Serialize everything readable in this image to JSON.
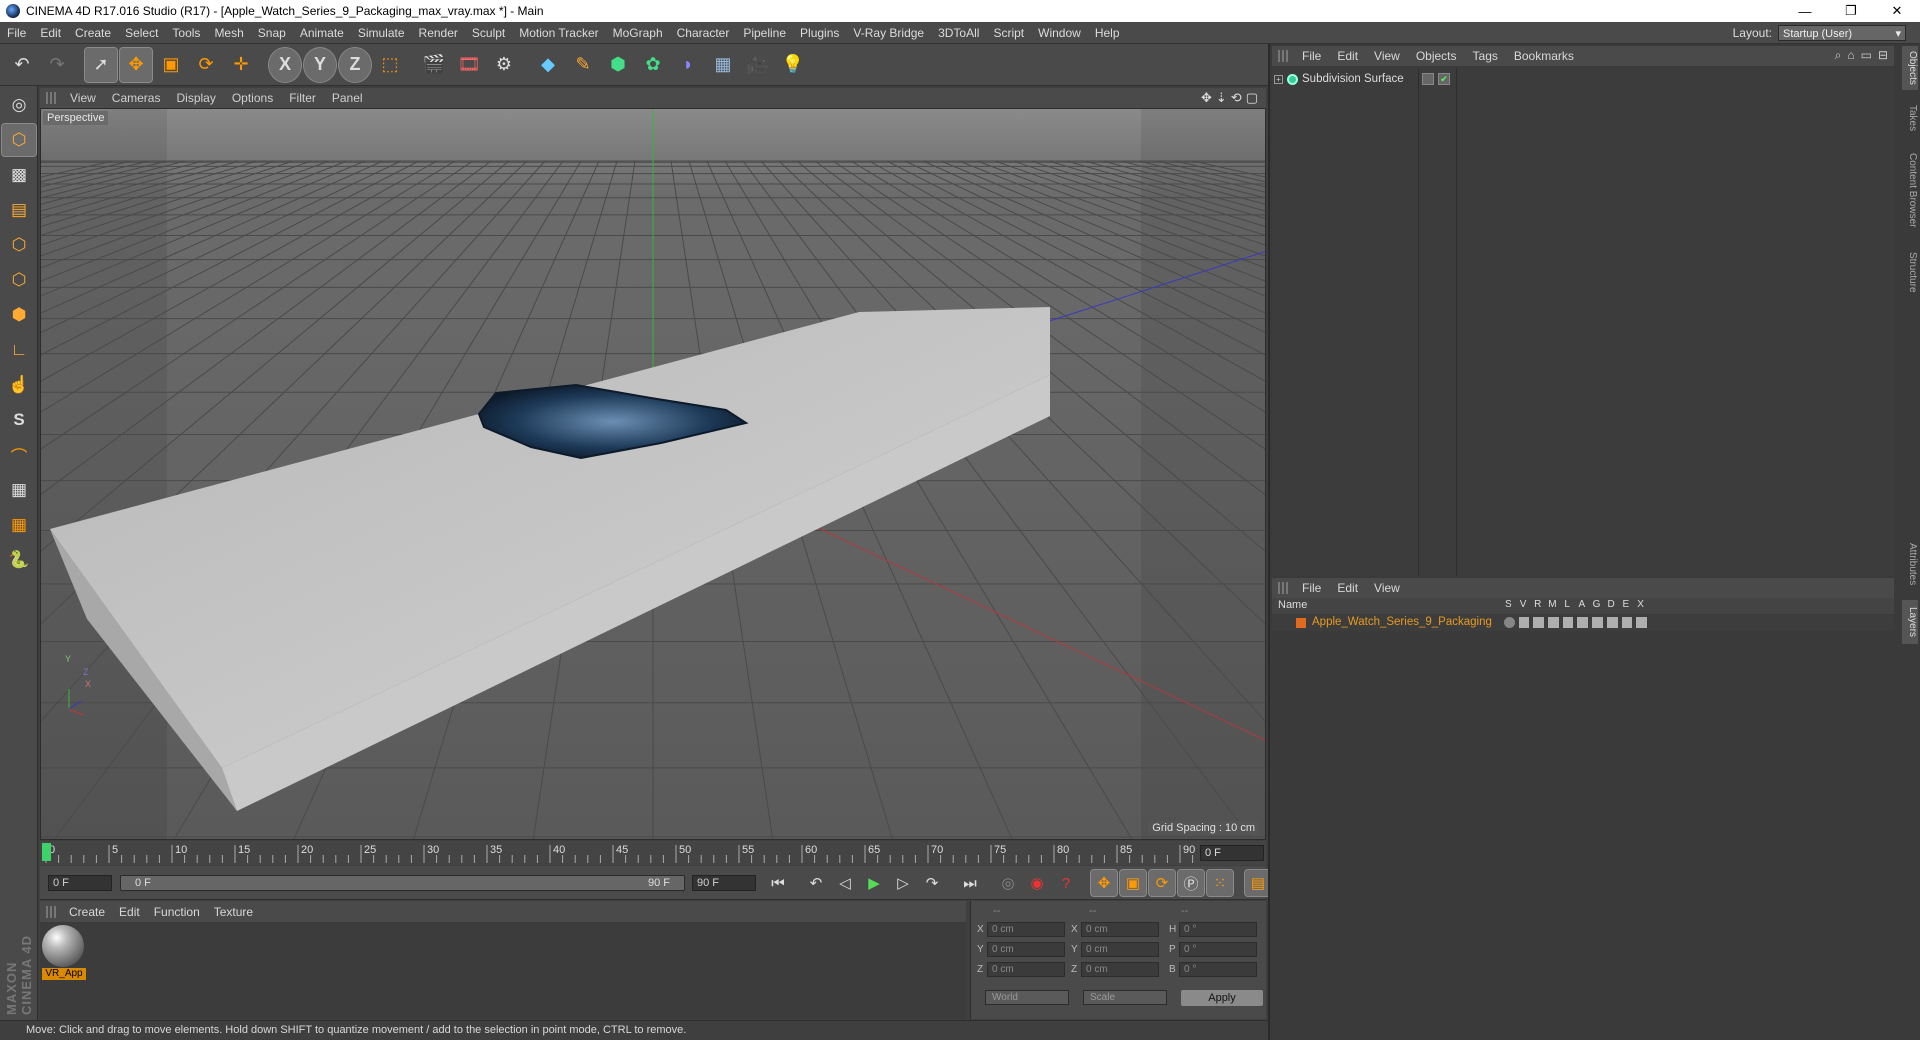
{
  "window": {
    "title": "CINEMA 4D R17.016 Studio (R17) - [Apple_Watch_Series_9_Packaging_max_vray.max *] - Main",
    "minimize": "—",
    "restore": "❐",
    "close": "✕"
  },
  "menubar": [
    "File",
    "Edit",
    "Create",
    "Select",
    "Tools",
    "Mesh",
    "Snap",
    "Animate",
    "Simulate",
    "Render",
    "Sculpt",
    "Motion Tracker",
    "MoGraph",
    "Character",
    "Pipeline",
    "Plugins",
    "V-Ray Bridge",
    "3DToAll",
    "Script",
    "Window",
    "Help"
  ],
  "layout": {
    "label": "Layout:",
    "value": "Startup (User)"
  },
  "toolbar": {
    "icons": [
      "undo-icon",
      "redo-icon",
      "select-icon",
      "move-icon",
      "scale-icon",
      "rotate-icon",
      "live-selection-icon",
      "x-axis-icon",
      "y-axis-icon",
      "z-axis-icon",
      "coordinate-system-icon",
      "render-view-icon",
      "render-picture-viewer-icon",
      "edit-render-settings-icon",
      "cube-icon",
      "pen-icon",
      "subdivision-icon",
      "cloner-icon",
      "deformer-icon",
      "floor-icon",
      "camera-icon",
      "light-icon"
    ],
    "axis_labels": [
      "X",
      "Y",
      "Z"
    ]
  },
  "left_toolbar": {
    "icons": [
      "model-mode-icon",
      "object-mode-icon",
      "texture-mode-icon",
      "workplane-icon",
      "points-mode-icon",
      "edges-mode-icon",
      "polygons-mode-icon",
      "axis-icon",
      "tweak-icon",
      "snap-icon",
      "magnet-icon",
      "lock-icon",
      "workplane-lock-icon",
      "python-icon"
    ],
    "snap_label": "S"
  },
  "viewport": {
    "menu": [
      "View",
      "Cameras",
      "Display",
      "Options",
      "Filter",
      "Panel"
    ],
    "label": "Perspective",
    "grid_spacing": "Grid Spacing : 10 cm",
    "axis_x": "X",
    "axis_y": "Y",
    "axis_z": "Z"
  },
  "timeline": {
    "ticks": [
      "0",
      "5",
      "10",
      "15",
      "20",
      "25",
      "30",
      "35",
      "40",
      "45",
      "50",
      "55",
      "60",
      "65",
      "70",
      "75",
      "80",
      "85",
      "90"
    ],
    "current_frame": "0 F"
  },
  "transport": {
    "start": "0 F",
    "range_start": "0 F",
    "range_end": "90 F",
    "end": "90 F"
  },
  "material_manager": {
    "menu": [
      "Create",
      "Edit",
      "Function",
      "Texture"
    ],
    "materials": [
      {
        "name": "VR_App"
      }
    ]
  },
  "coordinates": {
    "headers": [
      "--",
      "--",
      "--"
    ],
    "rows": [
      {
        "a1": "X",
        "v1": "0 cm",
        "a2": "X",
        "v2": "0 cm",
        "a3": "H",
        "v3": "0 °"
      },
      {
        "a1": "Y",
        "v1": "0 cm",
        "a2": "Y",
        "v2": "0 cm",
        "a3": "P",
        "v3": "0 °"
      },
      {
        "a1": "Z",
        "v1": "0 cm",
        "a2": "Z",
        "v2": "0 cm",
        "a3": "B",
        "v3": "0 °"
      }
    ],
    "mode_1": "World",
    "mode_2": "Scale",
    "apply": "Apply"
  },
  "status": "Move: Click and drag to move elements. Hold down SHIFT to quantize movement / add to the selection in point mode, CTRL to remove.",
  "maxon_logo": "MAXON CINEMA 4D",
  "object_manager": {
    "menu": [
      "File",
      "Edit",
      "View",
      "Objects",
      "Tags",
      "Bookmarks"
    ],
    "objects": [
      {
        "name": "Subdivision Surface"
      }
    ]
  },
  "layer_manager": {
    "menu": [
      "File",
      "Edit",
      "View"
    ],
    "header_name": "Name",
    "flags": [
      "S",
      "V",
      "R",
      "M",
      "L",
      "A",
      "G",
      "D",
      "E",
      "X"
    ],
    "layers": [
      {
        "name": "Apple_Watch_Series_9_Packaging",
        "color": "#e06a20"
      }
    ]
  },
  "side_tabs": [
    "Objects",
    "Takes",
    "Content Browser",
    "Structure",
    "Attributes",
    "Layers"
  ],
  "colors": {
    "accent": "#e89a20",
    "background": "#3f3f3f",
    "viewport": "#5f5f5f"
  }
}
